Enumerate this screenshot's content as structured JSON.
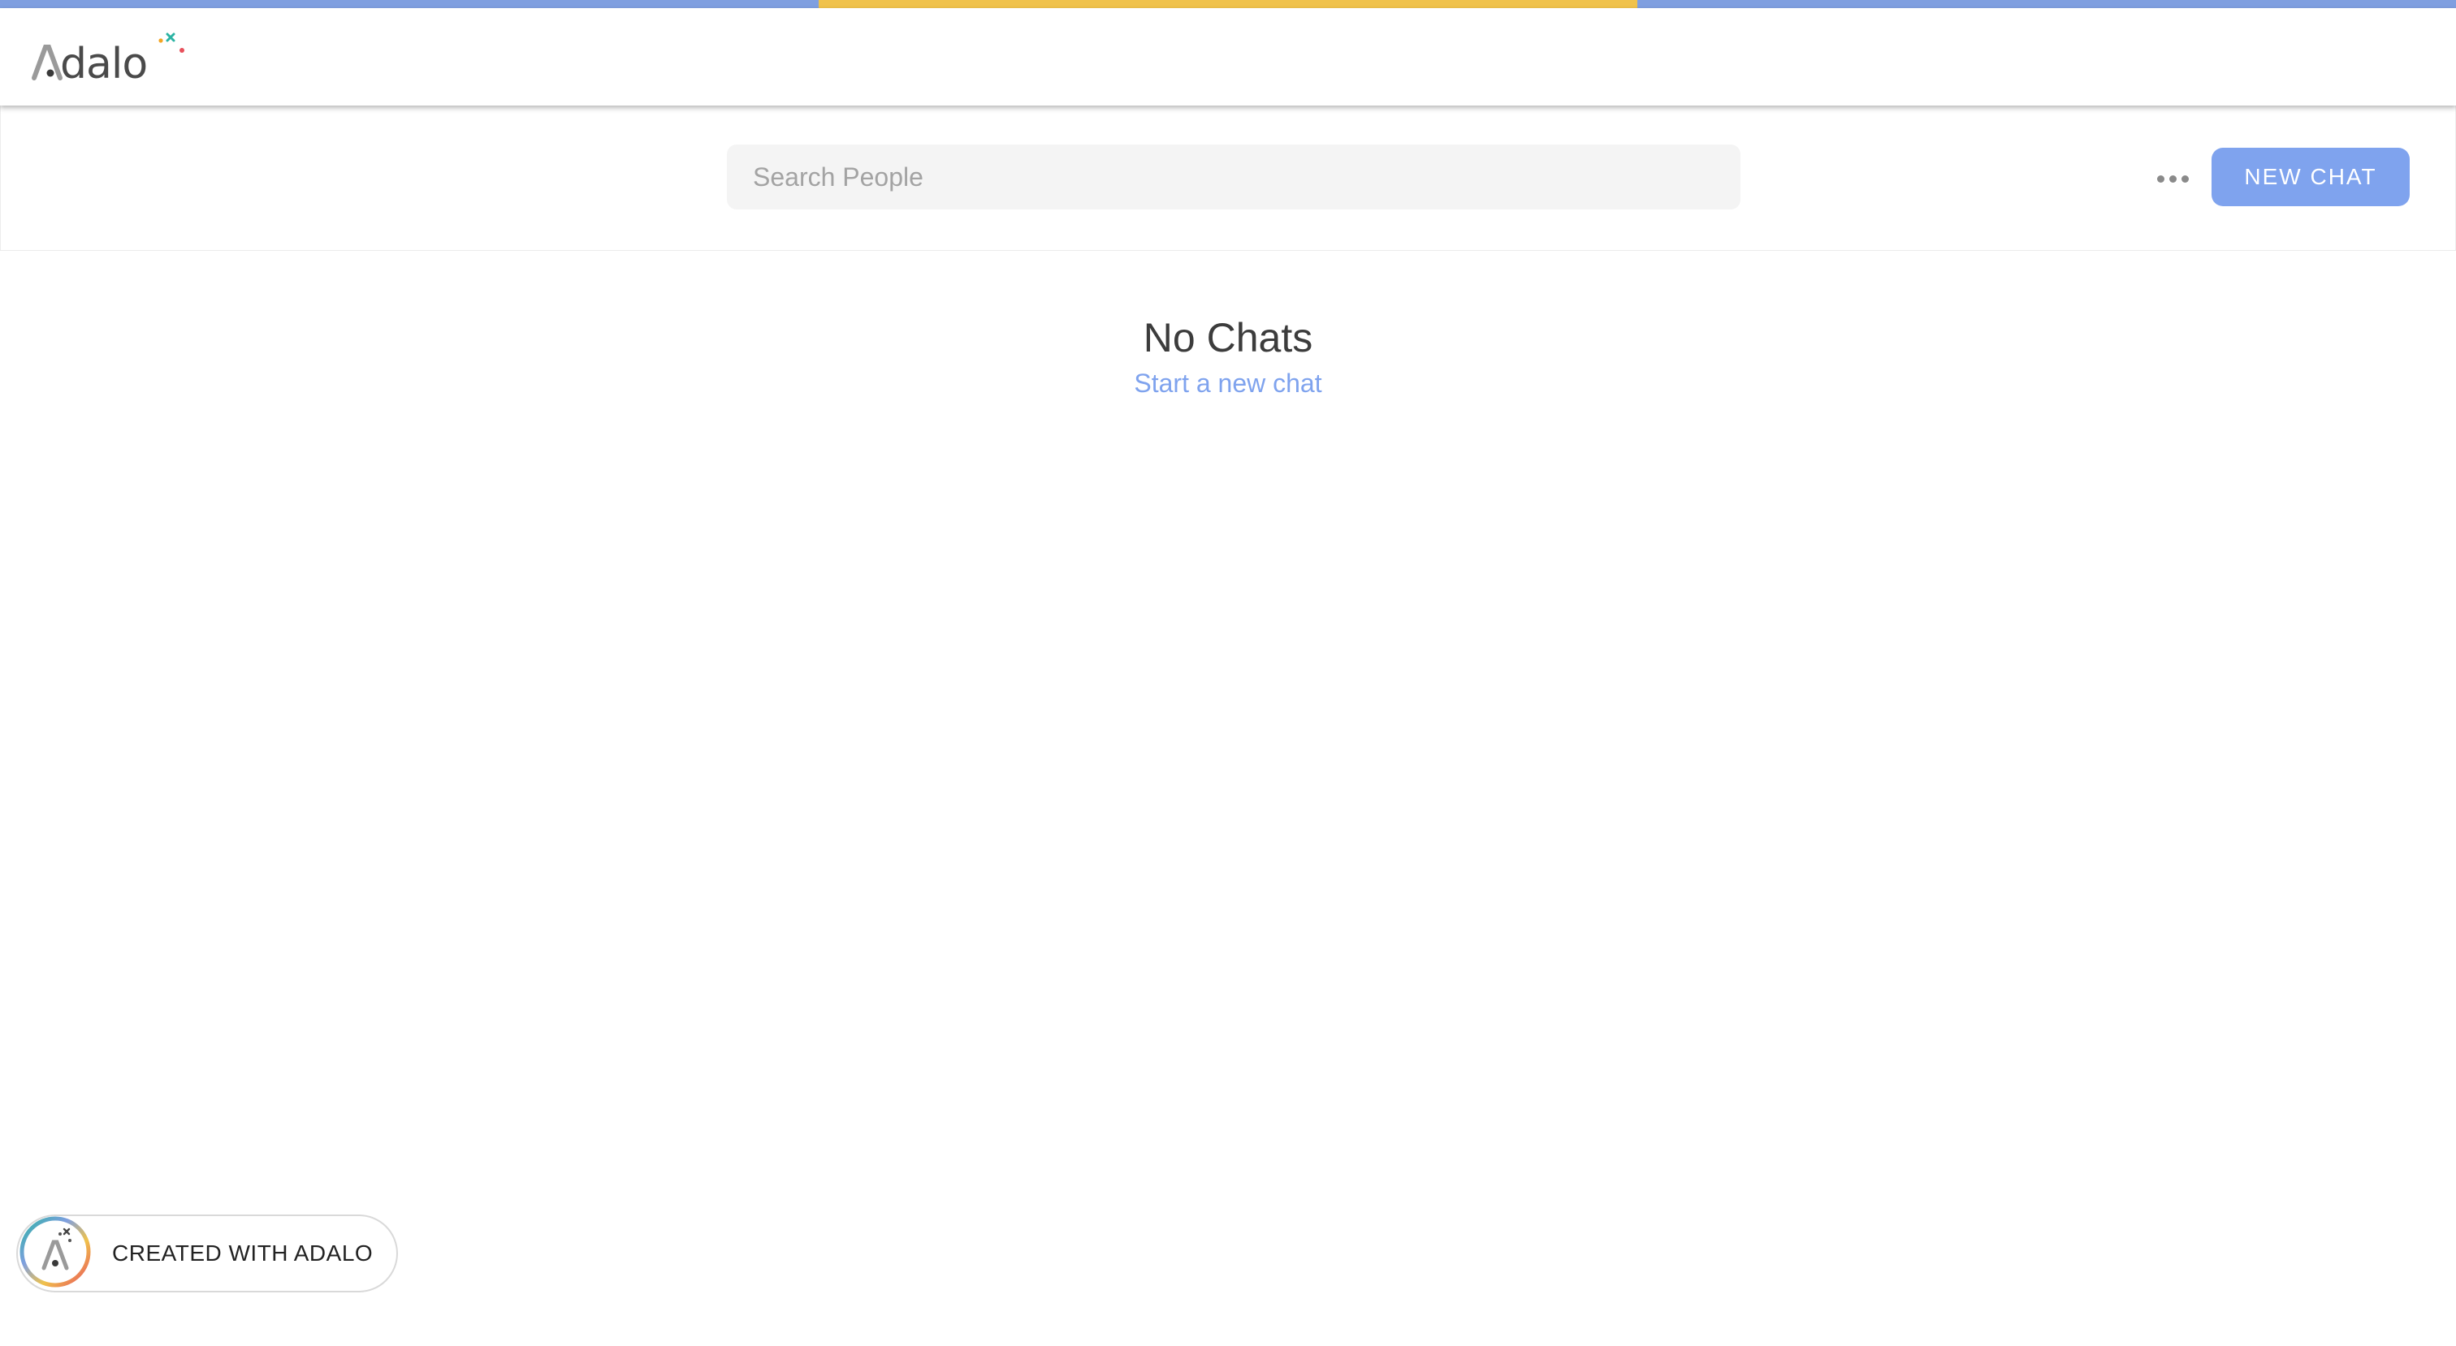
{
  "colors": {
    "stripe_blue": "#7f9fe0",
    "stripe_yellow": "#f0c24b",
    "accent": "#7fa3ee",
    "logo_star_teal": "#2bb3a3",
    "logo_star_orange": "#f4a623",
    "logo_star_red": "#e8505b"
  },
  "header": {
    "logo_text": "Adalo"
  },
  "toolbar": {
    "search_placeholder": "Search People",
    "search_value": "",
    "more_icon": "more-horizontal-icon",
    "new_chat_label": "NEW CHAT"
  },
  "empty_state": {
    "title": "No Chats",
    "link_label": "Start a new chat"
  },
  "badge": {
    "label": "CREATED WITH ADALO",
    "icon": "adalo-logo-icon"
  }
}
